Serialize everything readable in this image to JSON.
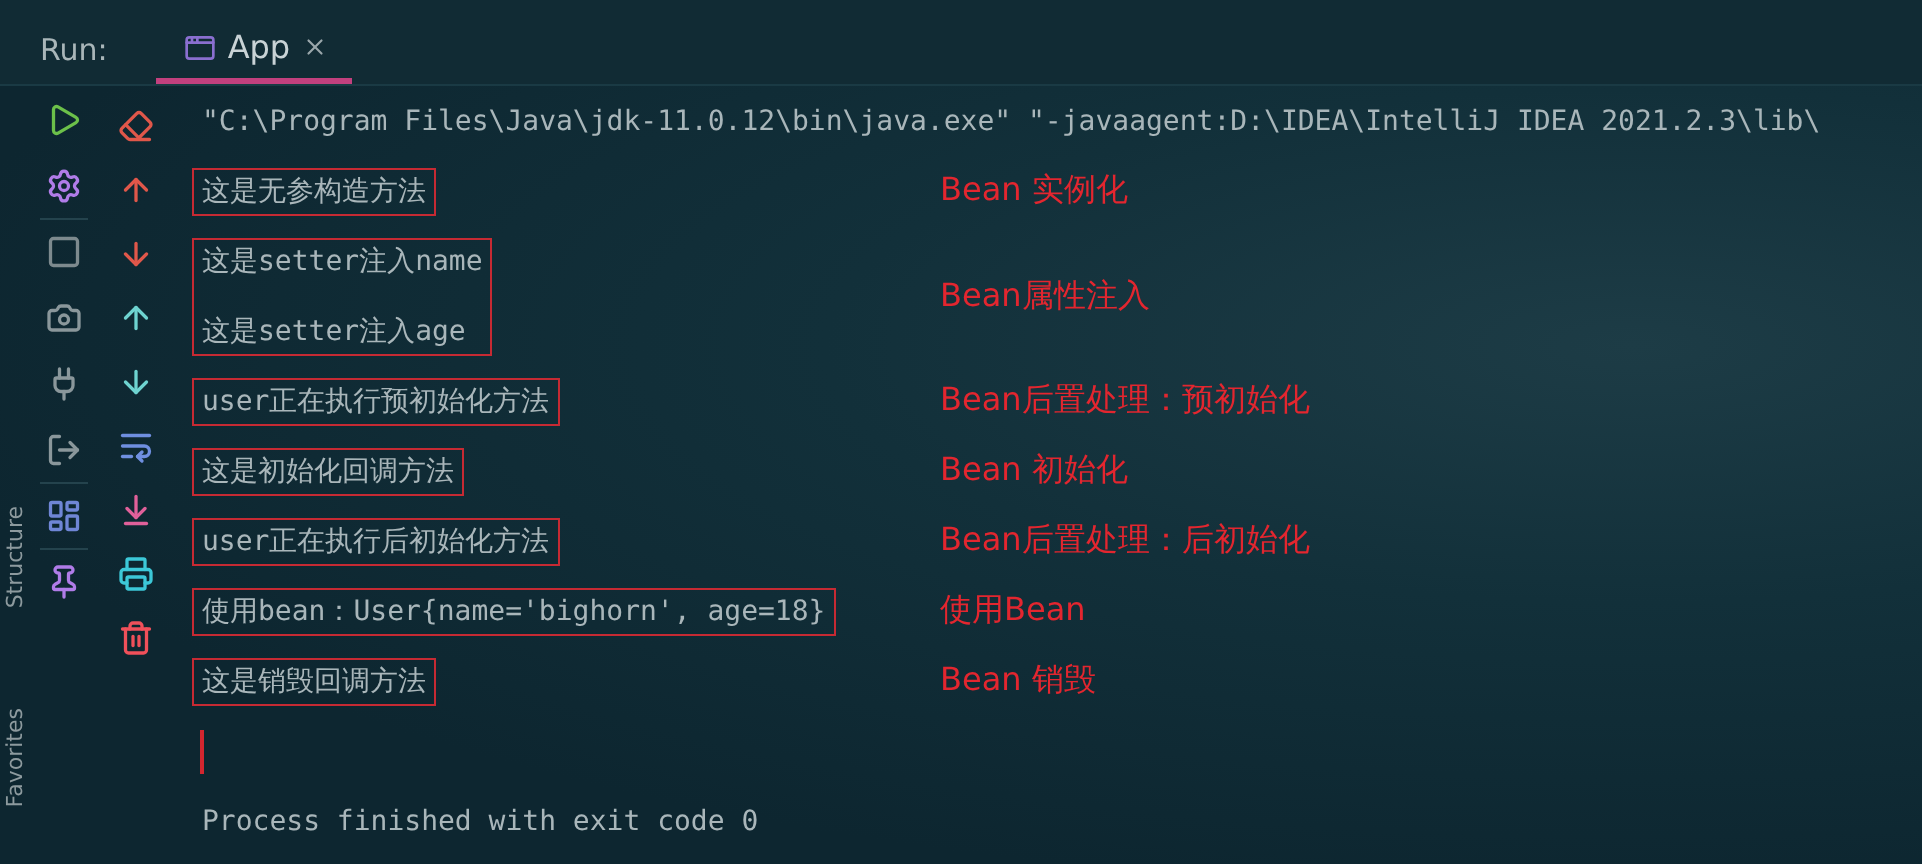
{
  "run_panel": {
    "label": "Run:",
    "tabs": [
      {
        "label": "App",
        "selected": true
      }
    ]
  },
  "side_labels": [
    "Structure",
    "Favorites"
  ],
  "console": [
    {
      "kind": "text",
      "lines": [
        "\"C:\\Program Files\\Java\\jdk-11.0.12\\bin\\java.exe\" \"-javaagent:D:\\IDEA\\IntelliJ IDEA 2021.2.3\\lib\\"
      ],
      "boxed": false
    },
    {
      "kind": "text",
      "lines": [
        "这是无参构造方法"
      ],
      "boxed": true,
      "note": "Bean 实例化"
    },
    {
      "kind": "text",
      "lines": [
        "这是setter注入name",
        "这是setter注入age"
      ],
      "boxed": true,
      "note": "Bean属性注入"
    },
    {
      "kind": "text",
      "lines": [
        "user正在执行预初始化方法"
      ],
      "boxed": true,
      "note": "Bean后置处理：预初始化"
    },
    {
      "kind": "text",
      "lines": [
        "这是初始化回调方法"
      ],
      "boxed": true,
      "note": "Bean 初始化"
    },
    {
      "kind": "text",
      "lines": [
        "user正在执行后初始化方法"
      ],
      "boxed": true,
      "note": "Bean后置处理：后初始化"
    },
    {
      "kind": "text",
      "lines": [
        "使用bean：User{name='bighorn', age=18}"
      ],
      "boxed": true,
      "note": "使用Bean"
    },
    {
      "kind": "text",
      "lines": [
        "这是销毁回调方法"
      ],
      "boxed": true,
      "note": "Bean 销毁"
    },
    {
      "kind": "cursor"
    },
    {
      "kind": "text",
      "lines": [
        "Process finished with exit code 0"
      ],
      "boxed": false
    }
  ]
}
